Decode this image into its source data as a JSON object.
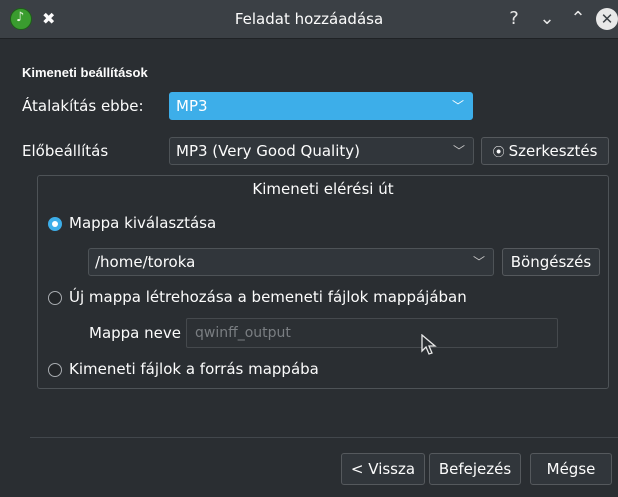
{
  "window": {
    "title": "Feladat hozzáadása",
    "help": "?",
    "minimize": "⌄",
    "maximize": "⌃",
    "close": "✕"
  },
  "output_settings": {
    "title": "Kimeneti beállítások",
    "convert_label": "Átalakítás ebbe:",
    "convert_value": "MP3",
    "preset_label": "Előbeállítás",
    "preset_value": "MP3 (Very Good Quality)",
    "edit_button": "Szerkesztés"
  },
  "output_path": {
    "group_title": "Kimeneti elérési út",
    "choose_folder": {
      "label": "Mappa kiválasztása",
      "selected": true
    },
    "folder_value": "/home/toroka",
    "browse_button": "Böngészés",
    "new_folder": {
      "label": "Új mappa létrehozása a bemeneti fájlok mappájában",
      "selected": false
    },
    "folder_name_label": "Mappa neve",
    "folder_name_placeholder": "qwinff_output",
    "source_folder": {
      "label": "Kimeneti fájlok a forrás mappába",
      "selected": false
    }
  },
  "footer": {
    "back_button": "< Vissza",
    "finish_button": "Befejezés",
    "cancel_button": "Mégse"
  },
  "colors": {
    "accent": "#3daee9",
    "background": "#2a2e32",
    "titlebar": "#3b4045"
  }
}
